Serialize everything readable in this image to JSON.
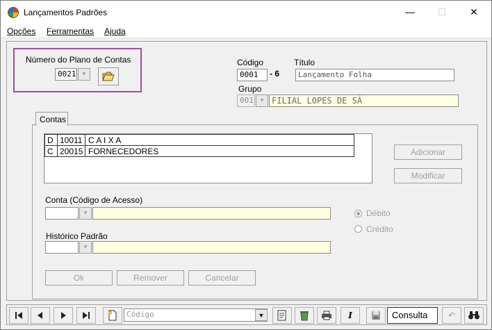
{
  "window": {
    "title": "Lançamentos Padrões",
    "minimize": "—",
    "maximize": "☐",
    "close": "✕"
  },
  "menu": {
    "opcoes": "Opções",
    "ferramentas": "Ferramentas",
    "ajuda": "Ajuda"
  },
  "plano": {
    "label": "Número do Plano de Contas",
    "value": "0021"
  },
  "header": {
    "codigo_label": "Código",
    "codigo_value": "0001",
    "separator": "- 6",
    "titulo_label": "Título",
    "titulo_value": "Lançamento Folha",
    "grupo_label": "Grupo",
    "grupo_code": "001",
    "grupo_name": "FILIAL LOPES DE SÁ"
  },
  "tab": {
    "label": "Contas"
  },
  "contas": [
    {
      "tipo": "D",
      "codigo": "10011",
      "nome": "C A I X A"
    },
    {
      "tipo": "C",
      "codigo": "20015",
      "nome": "FORNECEDORES"
    }
  ],
  "buttons": {
    "adicionar": "Adicionar",
    "modificar": "Modificar",
    "ok": "Ok",
    "remover": "Remover",
    "cancelar": "Cancelar"
  },
  "form": {
    "conta_label": "Conta (Código de Acesso)",
    "historico_label": "Histórico Padrão",
    "debito": "Débito",
    "credito": "Crédito"
  },
  "toolbar": {
    "search_placeholder": "Código",
    "mode": "Consulta"
  }
}
